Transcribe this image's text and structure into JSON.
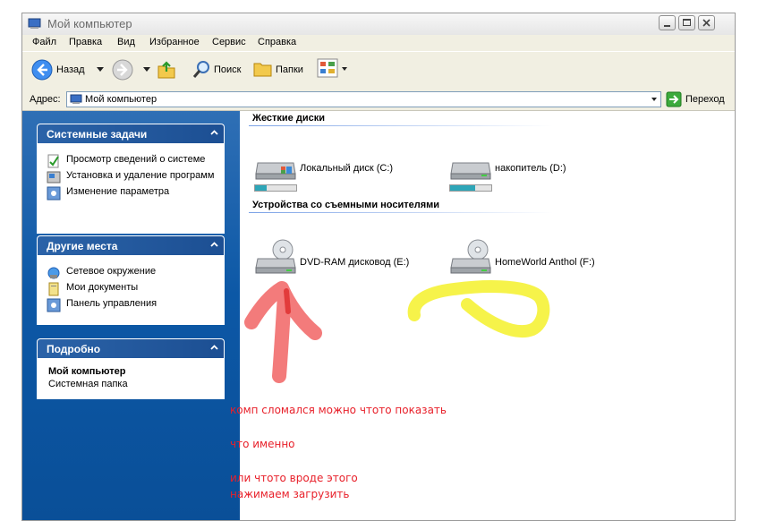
{
  "window": {
    "title": "Мой компьютер"
  },
  "menu": [
    "Файл",
    "Правка",
    "Вид",
    "Избранное",
    "Сервис",
    "Справка"
  ],
  "toolbar": {
    "back_label": "Назад",
    "search_label": "Поиск",
    "folders_label": "Папки"
  },
  "address": {
    "label": "Адрес:",
    "value": "Мой компьютер",
    "go_label": "Переход"
  },
  "tasks": {
    "system": {
      "title": "Системные задачи",
      "items": [
        "Просмотр сведений о системе",
        "Установка и удаление программ",
        "Изменение параметра"
      ]
    },
    "places": {
      "title": "Другие места",
      "items": [
        "Сетевое окружение",
        "Мои документы",
        "Панель управления"
      ]
    },
    "details": {
      "title": "Подробно",
      "name": "Мой компьютер",
      "desc": "Системная папка"
    }
  },
  "content": {
    "hard_disks_title": "Жесткие диски",
    "removable_title": "Устройства со съемными носителями",
    "hard_disks": [
      {
        "label": "Локальный диск (C:)",
        "used_fraction": 0.28
      },
      {
        "label": "накопитель (D:)",
        "used_fraction": 0.6
      }
    ],
    "removable": [
      {
        "label": "DVD-RAM дисковод (E:)"
      },
      {
        "label": "HomeWorld Anthol (F:)"
      }
    ]
  },
  "annotations": [
    "комп сломался можно чтото показать",
    "что именно",
    "или чтото вроде этого",
    "нажимаем загрузить"
  ],
  "colors": {
    "annotation_text": "#e8202a",
    "arrow": "#f26d6d",
    "scribble": "#f6f34a",
    "task_pane": "#0c58a6"
  }
}
